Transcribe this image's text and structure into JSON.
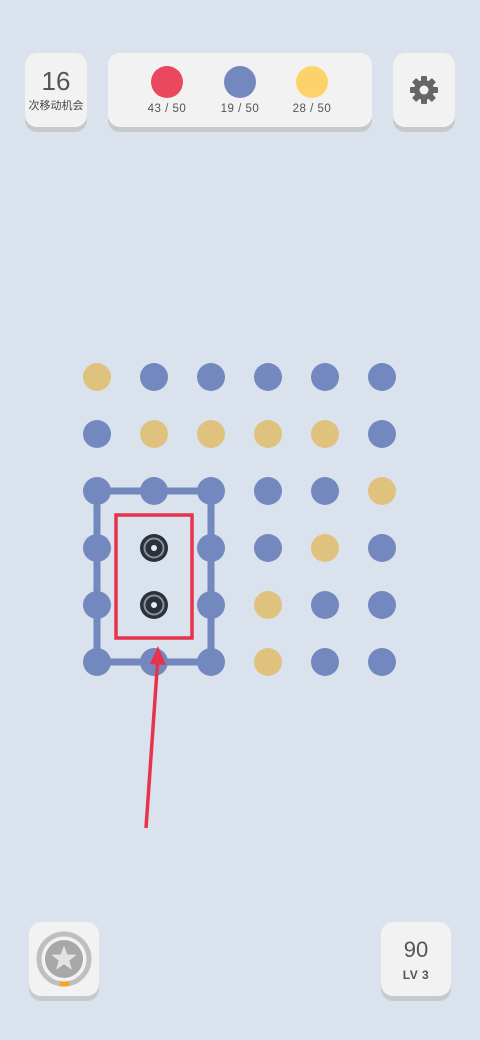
{
  "moves": {
    "count": "16",
    "label": "次移动机会"
  },
  "goals": [
    {
      "color": "#e9485f",
      "text": "43 / 50"
    },
    {
      "color": "#7288bf",
      "text": "19 / 50"
    },
    {
      "color": "#fdd26a",
      "text": "28 / 50"
    }
  ],
  "settings": {
    "icon": "gear-icon"
  },
  "powerup": {
    "icon": "star-icon",
    "progress": 0.06,
    "progress_color": "#f5a623"
  },
  "score": {
    "value": "90",
    "level": "LV 3"
  },
  "board": {
    "colors": {
      "B": "#7288bf",
      "Y": "#e0c27f",
      "A": "#2b313a"
    },
    "rows": [
      [
        "Y",
        "B",
        "B",
        "B",
        "B",
        "B"
      ],
      [
        "B",
        "Y",
        "Y",
        "Y",
        "Y",
        "B"
      ],
      [
        "B",
        "B",
        "B",
        "B",
        "B",
        "Y"
      ],
      [
        "B",
        "A",
        "B",
        "B",
        "Y",
        "B"
      ],
      [
        "B",
        "A",
        "B",
        "Y",
        "B",
        "B"
      ],
      [
        "B",
        "B",
        "B",
        "Y",
        "B",
        "B"
      ]
    ],
    "selection_loop": {
      "from_col": 0,
      "to_col": 2,
      "from_row": 2,
      "to_row": 5,
      "color": "#7288bf"
    },
    "highlight_box": {
      "from_col": 1,
      "to_col": 1,
      "from_row": 3,
      "to_row": 4,
      "color": "#e8334a"
    }
  }
}
